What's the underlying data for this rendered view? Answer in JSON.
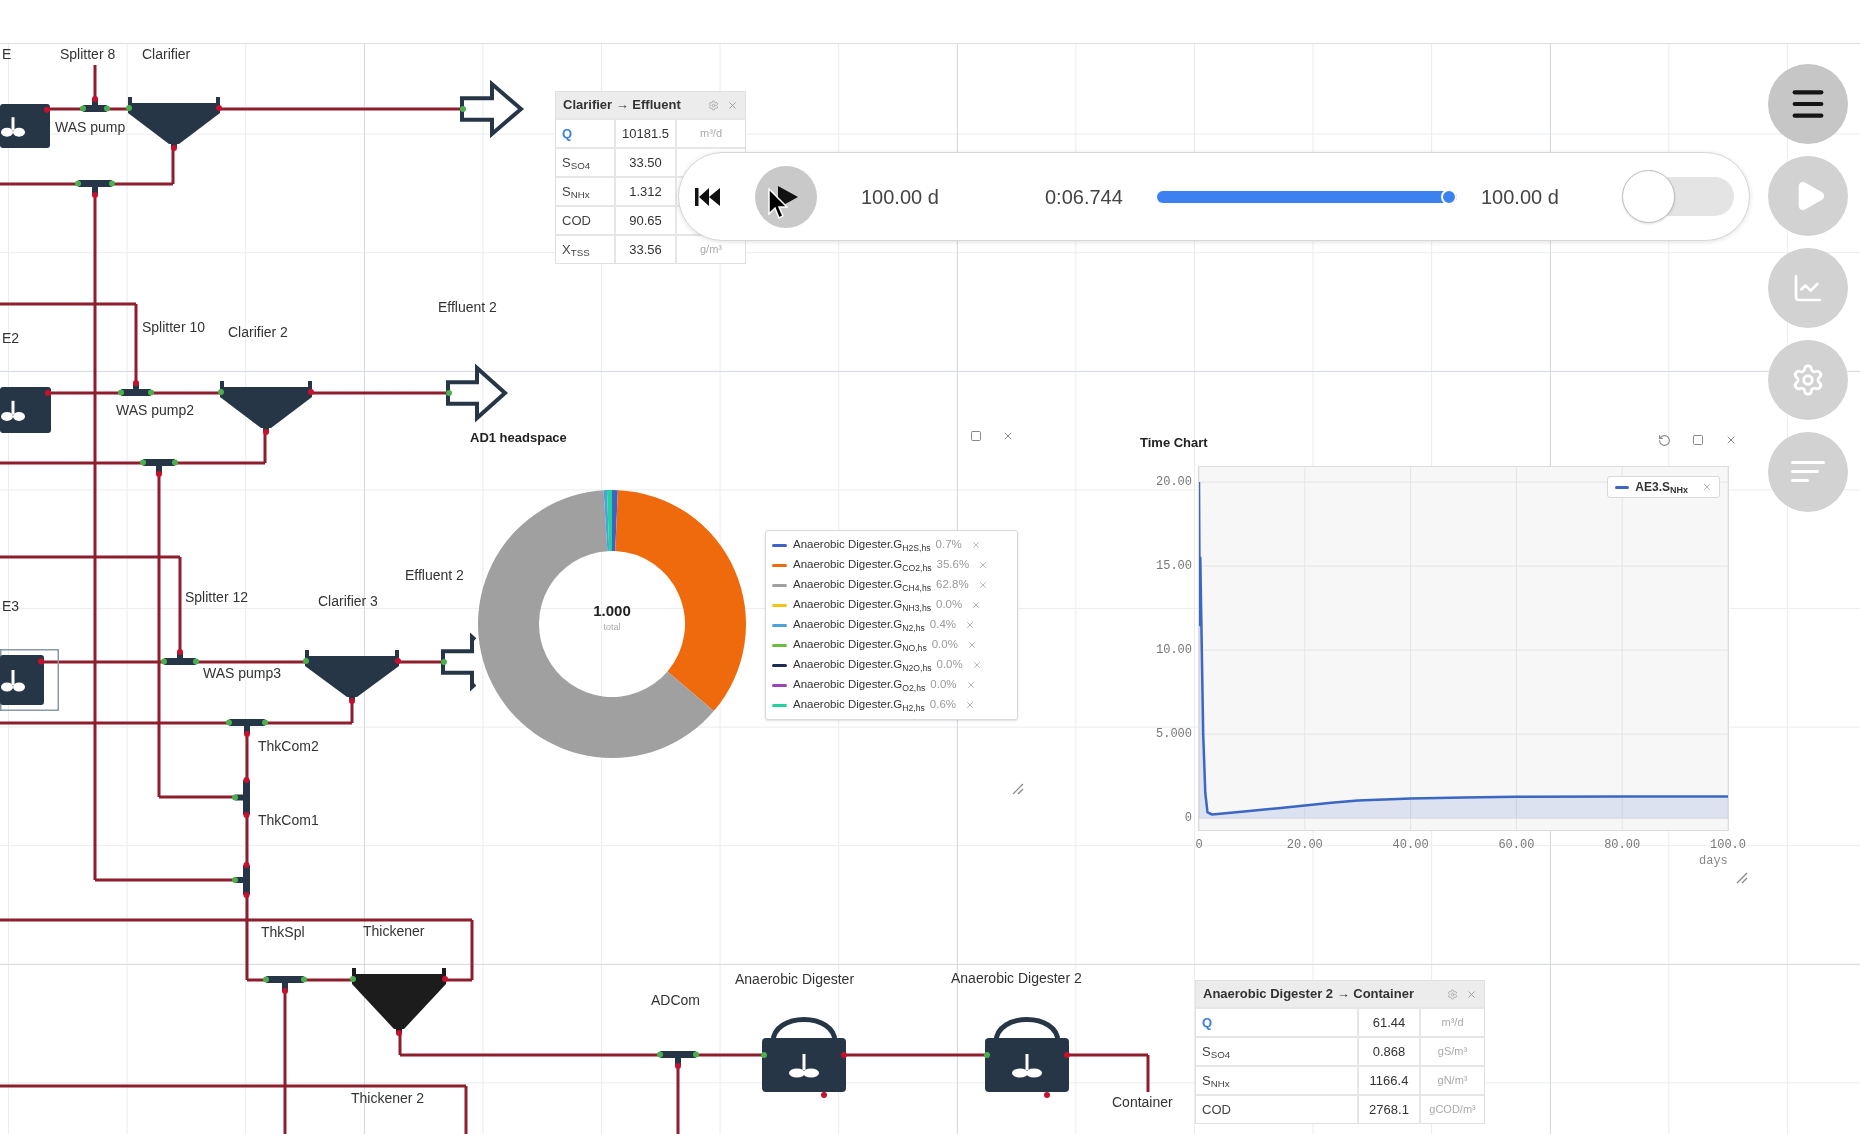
{
  "canvas": {
    "labels": [
      "E",
      "Splitter 8",
      "Clarifier",
      "WAS pump",
      "E2",
      "Splitter 10",
      "Clarifier 2",
      "Effluent 2",
      "WAS pump2",
      "E3",
      "Splitter 12",
      "Clarifier 3",
      "Effluent 2",
      "WAS pump3",
      "ThkCom2",
      "ThkCom1",
      "ThkSpl",
      "Thickener",
      "ADCom",
      "Anaerobic Digester",
      "Anaerobic Digester 2",
      "Thickener 2",
      "Container"
    ],
    "units": [
      {
        "kind": "reactor",
        "selected": false
      },
      {
        "kind": "splitter",
        "selected": false
      },
      {
        "kind": "clarifier",
        "selected": false
      },
      {
        "kind": "splitter",
        "selected": false
      },
      {
        "kind": "effluent",
        "selected": false
      },
      {
        "kind": "reactor",
        "selected": false
      },
      {
        "kind": "splitter",
        "selected": false
      },
      {
        "kind": "clarifier",
        "selected": false
      },
      {
        "kind": "splitter",
        "selected": false
      },
      {
        "kind": "effluent",
        "selected": false
      },
      {
        "kind": "reactor",
        "selected": true
      },
      {
        "kind": "splitter",
        "selected": false
      },
      {
        "kind": "clarifier",
        "selected": false
      },
      {
        "kind": "effluent",
        "selected": false
      },
      {
        "kind": "splitter",
        "selected": false
      },
      {
        "kind": "splitter",
        "selected": false
      },
      {
        "kind": "splitter",
        "selected": false
      },
      {
        "kind": "splitter",
        "selected": false
      },
      {
        "kind": "thickener",
        "selected": true
      },
      {
        "kind": "splitter",
        "selected": false
      },
      {
        "kind": "digester",
        "selected": false
      },
      {
        "kind": "digester",
        "selected": false
      }
    ]
  },
  "stream_tables": [
    {
      "title": "Clarifier → Effluent",
      "rows": [
        {
          "kind": "flow",
          "name": "Q",
          "value": "10181.5",
          "unit": "m³/d"
        },
        {
          "kind": "variable",
          "name": "S$_{SO4}$",
          "value": "33.50"
        },
        {
          "kind": "variable",
          "name": "S$_{NHx}$",
          "value": "1.312"
        },
        {
          "kind": "variable",
          "name": "COD",
          "value": "90.65"
        },
        {
          "kind": "variable",
          "name": "X$_{TSS}$",
          "value": "33.56",
          "unit": "g/m³"
        }
      ]
    },
    {
      "title": "Anaerobic Digester 2 → Container",
      "rows": [
        {
          "kind": "flow",
          "name": "Q",
          "value": "61.44",
          "unit": "m³/d"
        },
        {
          "kind": "variable",
          "name": "S$_{SO4}$",
          "value": "0.868",
          "unit": "gS/m³"
        },
        {
          "kind": "variable",
          "name": "S$_{NHx}$",
          "value": "1166.4",
          "unit": "gN/m³"
        },
        {
          "kind": "variable",
          "name": "COD",
          "value": "2768.1",
          "unit": "gCOD/m³"
        }
      ]
    }
  ],
  "player": {
    "start_time": "100.00 d",
    "elapsed": "0:06.744",
    "level": 1.0,
    "end_time": "100.00 d",
    "switch": {
      "on": false
    }
  },
  "side_buttons": [
    {
      "disabled": false
    },
    {
      "disabled": true
    },
    {
      "disabled": true
    },
    {
      "disabled": true
    },
    {
      "disabled": true
    }
  ],
  "pie_panel": {
    "title": "AD1 headspace",
    "center_value": "1.000",
    "center_caption": "total",
    "chart_data": {
      "type": "donut",
      "categories": [
        "Anaerobic Digester.G$_{H2S,hs}$",
        "Anaerobic Digester.G$_{CO2,hs}$",
        "Anaerobic Digester.G$_{CH4,hs}$",
        "Anaerobic Digester.G$_{NH3,hs}$",
        "Anaerobic Digester.G$_{N2,hs}$",
        "Anaerobic Digester.G$_{NO,hs}$",
        "Anaerobic Digester.G$_{N2O,hs}$",
        "Anaerobic Digester.G$_{O2,hs}$",
        "Anaerobic Digester.G$_{H2,hs}$"
      ],
      "values": [
        0.7,
        35.6,
        62.8,
        0.0,
        0.4,
        0.0,
        0.0,
        0.0,
        0.6
      ]
    },
    "legend": [
      {
        "percent": "0.7%",
        "color": "#3f63c4"
      },
      {
        "percent": "35.6%",
        "color": "#ef6a0c"
      },
      {
        "percent": "62.8%",
        "color": "#a0a0a0"
      },
      {
        "percent": "0.0%",
        "color": "#f2c417"
      },
      {
        "percent": "0.4%",
        "color": "#4ba3dc"
      },
      {
        "percent": "0.0%",
        "color": "#6cbd3c"
      },
      {
        "percent": "0.0%",
        "color": "#1e2b57"
      },
      {
        "percent": "0.0%",
        "color": "#9a43bd"
      },
      {
        "percent": "0.6%",
        "color": "#22d19e"
      }
    ]
  },
  "time_chart": {
    "title": "Time Chart",
    "chart_data": {
      "type": "area",
      "xlabel": "days",
      "x": [
        0,
        0.15,
        0.25,
        0.8,
        1.2,
        1.6,
        2.5,
        5,
        10,
        15,
        20,
        25,
        30,
        40,
        50,
        60,
        80,
        100
      ],
      "series": [
        {
          "name": "AE3.S$_{NHx}$",
          "color": "#3b66c4",
          "values": [
            20,
            11.5,
            15.5,
            5,
            1.5,
            0.35,
            0.22,
            0.3,
            0.45,
            0.6,
            0.75,
            0.92,
            1.05,
            1.17,
            1.24,
            1.28,
            1.29,
            1.29
          ]
        }
      ],
      "xlim": [
        0,
        100
      ],
      "ylim": [
        -0.7,
        20.9
      ],
      "xticks": [
        {
          "value": 0,
          "label": "0"
        },
        {
          "value": 20,
          "label": "20.00"
        },
        {
          "value": 40,
          "label": "40.00"
        },
        {
          "value": 60,
          "label": "60.00"
        },
        {
          "value": 80,
          "label": "80.00"
        },
        {
          "value": 100,
          "label": "100.0"
        }
      ],
      "yticks": [
        {
          "value": 0,
          "label": "0"
        },
        {
          "value": 5,
          "label": "5.000"
        },
        {
          "value": 10,
          "label": "10.00"
        },
        {
          "value": 15,
          "label": "15.00"
        },
        {
          "value": 20,
          "label": "20.00"
        }
      ],
      "grid": true
    }
  }
}
